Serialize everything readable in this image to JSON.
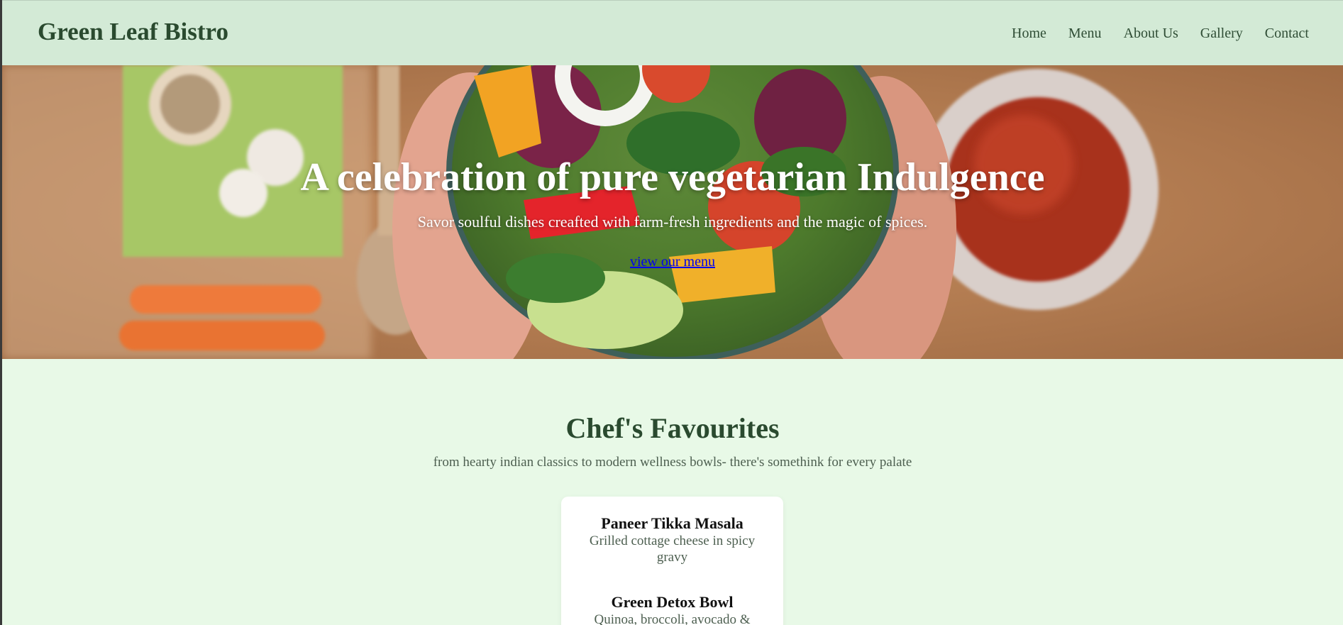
{
  "header": {
    "brand": "Green Leaf Bistro",
    "nav": [
      "Home",
      "Menu",
      "About Us",
      "Gallery",
      "Contact"
    ]
  },
  "hero": {
    "title": "A celebration of pure vegetarian Indulgence",
    "subtitle": "Savor soulful dishes creafted with farm-fresh ingredients and the magic of spices.",
    "link_label": "view our menu"
  },
  "favourites": {
    "title": "Chef's Favourites",
    "subtitle": "from hearty indian classics to modern wellness bowls- there's somethink for every palate",
    "dishes": [
      {
        "name": "Paneer Tikka Masala",
        "description": "Grilled cottage cheese in spicy gravy"
      },
      {
        "name": "Green Detox Bowl",
        "description": "Quinoa, broccoli, avocado &"
      }
    ]
  },
  "colors": {
    "header_bg": "#d3ead6",
    "page_bg": "#e8f9e7",
    "brand_text": "#2a4a2f",
    "link": "#0000ee"
  },
  "icons": [
    "salad-bowl-hero-image"
  ]
}
